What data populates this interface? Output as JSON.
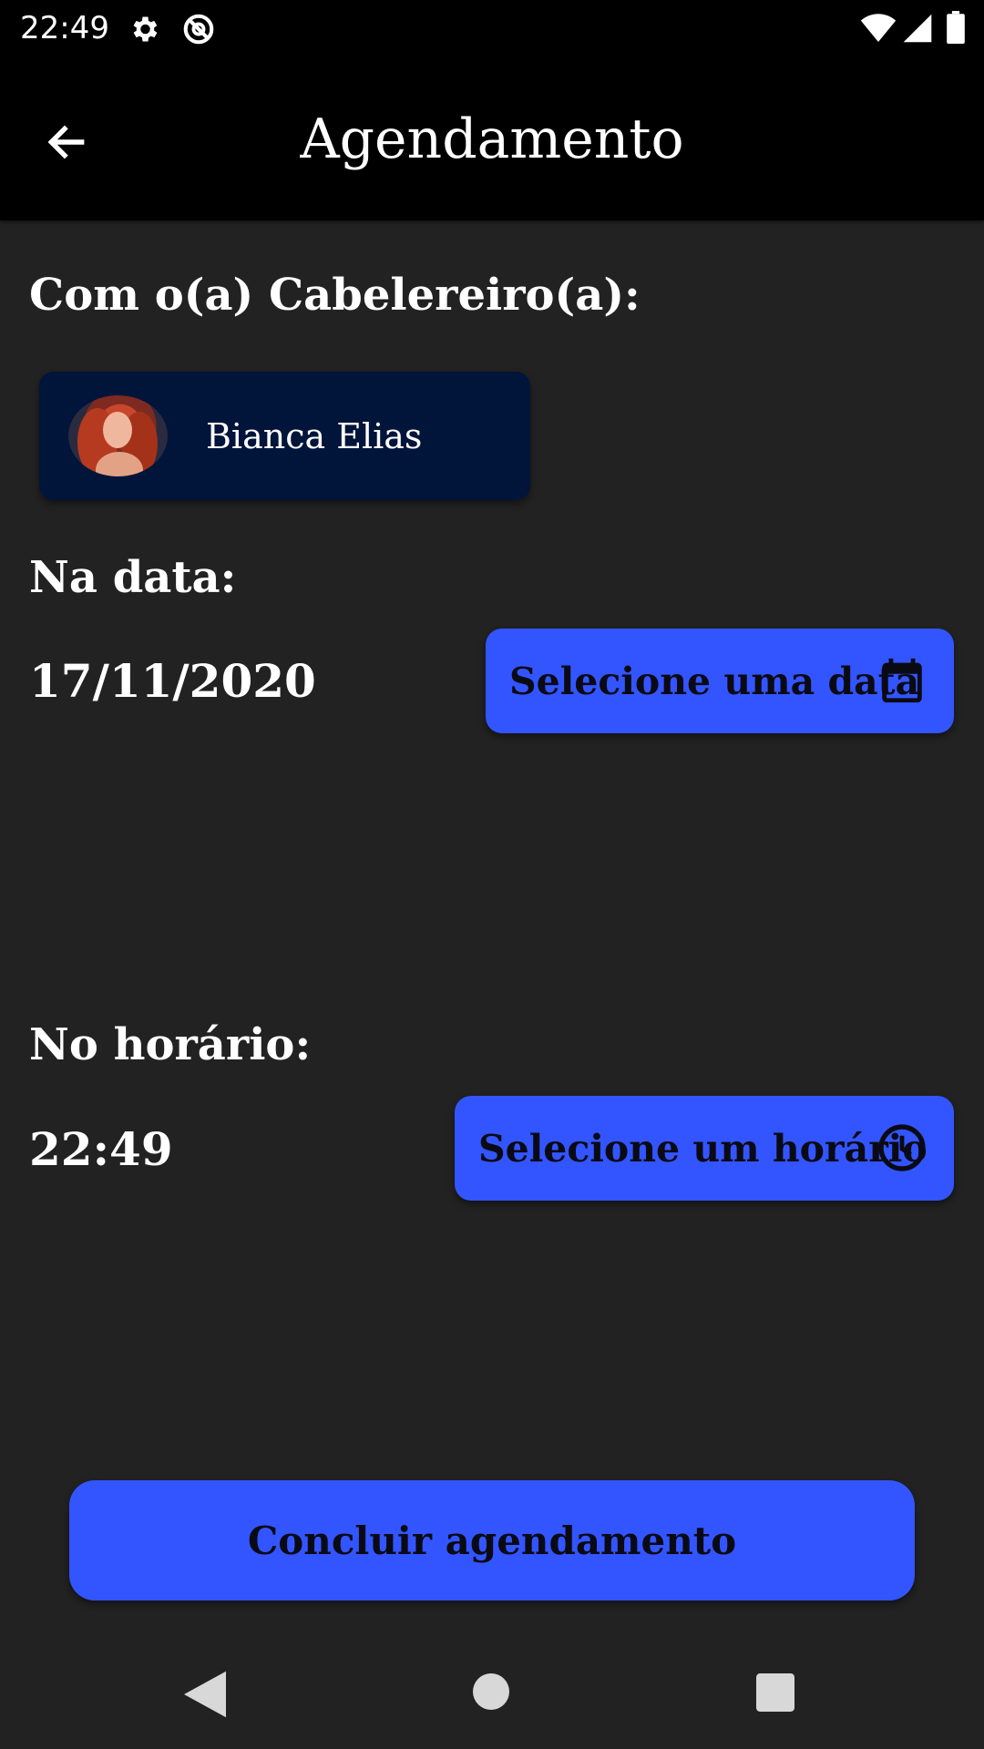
{
  "status_bar": {
    "time": "22:49",
    "icons": [
      "settings-icon",
      "no-sync-icon",
      "wifi-icon",
      "signal-icon",
      "battery-icon"
    ]
  },
  "app_bar": {
    "back_icon": "arrow-left-icon",
    "title": "Agendamento"
  },
  "stylist_section": {
    "label": "Com o(a) Cabelereiro(a):",
    "name": "Bianca Elias"
  },
  "date_section": {
    "label": "Na data:",
    "value": "17/11/2020",
    "button_label": "Selecione uma data",
    "button_icon": "calendar-icon"
  },
  "time_section": {
    "label": "No horário:",
    "value": "22:49",
    "button_label": "Selecione um horário",
    "button_icon": "clock-icon"
  },
  "submit_button": {
    "label": "Concluir agendamento"
  },
  "nav_bar": {
    "icons": [
      "back-triangle-icon",
      "home-circle-icon",
      "recents-square-icon"
    ]
  },
  "colors": {
    "background": "#222222",
    "app_bar": "#000000",
    "card": "#01143a",
    "accent": "#3355ff"
  }
}
